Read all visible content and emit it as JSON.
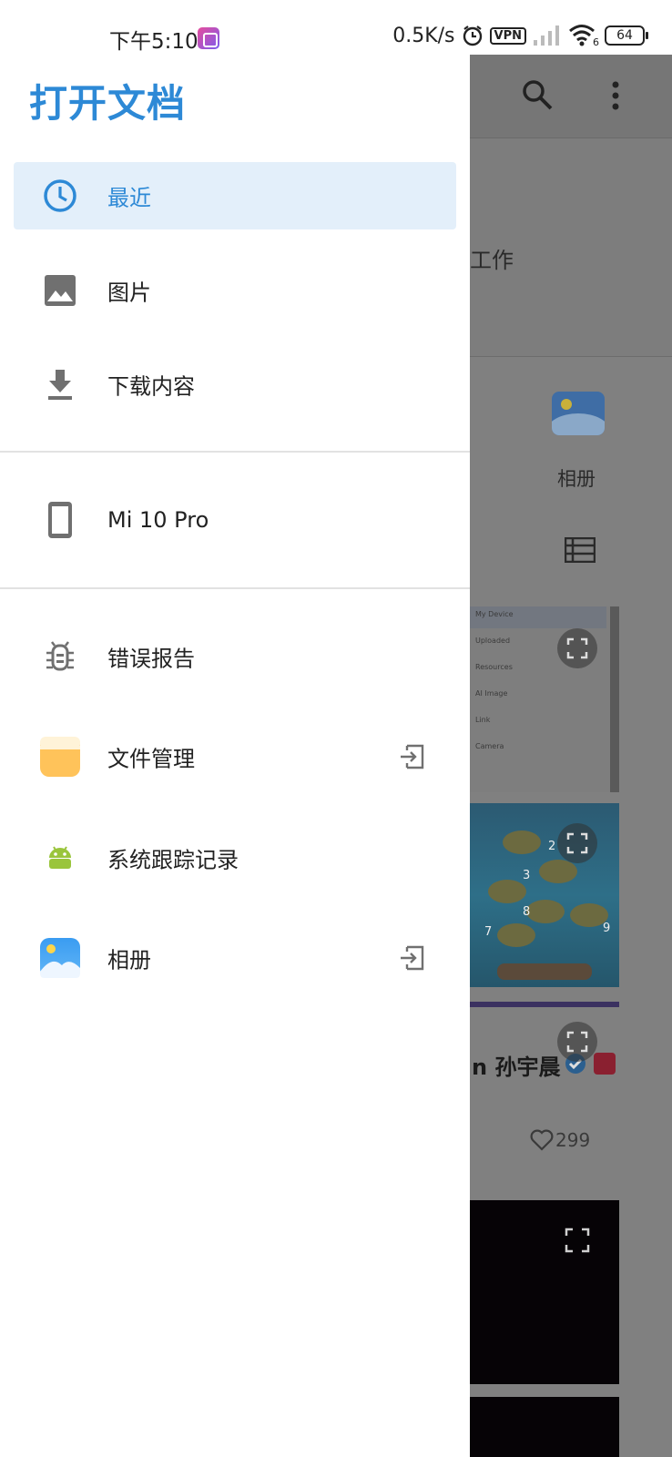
{
  "status_bar": {
    "time": "下午5:10",
    "net_speed": "0.5K/s",
    "vpn": "VPN",
    "wifi_sub": "6",
    "battery": "64"
  },
  "drawer": {
    "title": "打开文档",
    "items": [
      {
        "label": "最近",
        "icon": "clock-icon",
        "active": true
      },
      {
        "label": "图片",
        "icon": "image-icon"
      },
      {
        "label": "下载内容",
        "icon": "download-icon"
      },
      {
        "label": "Mi 10 Pro",
        "icon": "phone-icon"
      },
      {
        "label": "错误报告",
        "icon": "bug-icon"
      },
      {
        "label": "文件管理",
        "icon": "file-manager-icon",
        "external": true
      },
      {
        "label": "系统跟踪记录",
        "icon": "android-icon"
      },
      {
        "label": "相册",
        "icon": "gallery-icon",
        "external": true
      }
    ]
  },
  "background": {
    "section_label": "工作",
    "album_label": "相册",
    "thumb1_menu": [
      "My Device",
      "Uploaded",
      "Resources",
      "AI Image",
      "Link",
      "Camera"
    ],
    "island_numbers": [
      "2",
      "3",
      "8",
      "7",
      "9"
    ],
    "post_name": "n 孙宇晨",
    "post_likes": "299"
  },
  "colors": {
    "accent": "#2d89d6",
    "active_bg": "#e3effa",
    "icon_gray": "#707070",
    "file_manager": "#ffc35a",
    "android_green": "#9ac53c"
  }
}
